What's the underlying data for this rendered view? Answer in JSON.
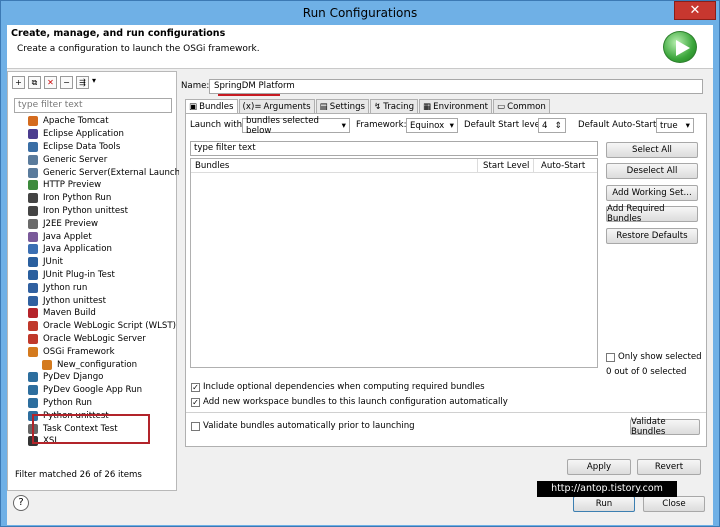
{
  "window": {
    "title": "Run Configurations",
    "close_glyph": "✕"
  },
  "header": {
    "title": "Create, manage, and run configurations",
    "subtitle": "Create a configuration to launch the OSGi framework."
  },
  "left": {
    "filter_placeholder": "type filter text",
    "items": [
      {
        "label": "Apache Tomcat",
        "icon": "tomcat-icon"
      },
      {
        "label": "Eclipse Application",
        "icon": "eclipse-icon"
      },
      {
        "label": "Eclipse Data Tools",
        "icon": "data-tools-icon"
      },
      {
        "label": "Generic Server",
        "icon": "server-icon"
      },
      {
        "label": "Generic Server(External Launch)",
        "icon": "server-icon"
      },
      {
        "label": "HTTP Preview",
        "icon": "http-icon"
      },
      {
        "label": "Iron Python Run",
        "icon": "ironpython-icon"
      },
      {
        "label": "Iron Python unittest",
        "icon": "ironpython-icon"
      },
      {
        "label": "J2EE Preview",
        "icon": "j2ee-icon"
      },
      {
        "label": "Java Applet",
        "icon": "applet-icon"
      },
      {
        "label": "Java Application",
        "icon": "java-app-icon"
      },
      {
        "label": "JUnit",
        "icon": "junit-icon"
      },
      {
        "label": "JUnit Plug-in Test",
        "icon": "junit-plugin-icon"
      },
      {
        "label": "Jython run",
        "icon": "jython-icon"
      },
      {
        "label": "Jython unittest",
        "icon": "jython-icon"
      },
      {
        "label": "Maven Build",
        "icon": "maven-icon"
      },
      {
        "label": "Oracle WebLogic Script (WLST)",
        "icon": "weblogic-icon"
      },
      {
        "label": "Oracle WebLogic Server",
        "icon": "weblogic-icon"
      },
      {
        "label": "OSGi Framework",
        "icon": "osgi-icon"
      },
      {
        "label": "New_configuration",
        "icon": "osgi-icon",
        "child": true
      },
      {
        "label": "PyDev Django",
        "icon": "pydev-icon"
      },
      {
        "label": "PyDev Google App Run",
        "icon": "pydev-icon"
      },
      {
        "label": "Python Run",
        "icon": "python-icon"
      },
      {
        "label": "Python unittest",
        "icon": "python-icon"
      },
      {
        "label": "Task Context Test",
        "icon": "task-icon"
      },
      {
        "label": "XSL",
        "icon": "xsl-icon"
      }
    ],
    "matched": "Filter matched 26 of 26 items"
  },
  "right": {
    "name_label": "Name:",
    "name_value": "SpringDM Platform",
    "tabs": [
      "Bundles",
      "Arguments",
      "Settings",
      "Tracing",
      "Environment",
      "Common"
    ],
    "launch_with_label": "Launch with:",
    "launch_with_value": "bundles selected below",
    "framework_label": "Framework:",
    "framework_value": "Equinox",
    "start_level_label": "Default Start level:",
    "start_level_value": "4",
    "auto_start_label": "Default Auto-Start:",
    "auto_start_value": "true",
    "bundle_filter": "type filter text",
    "col_bundles": "Bundles",
    "col_start": "Start Level",
    "col_auto": "Auto-Start",
    "buttons": [
      "Select All",
      "Deselect All",
      "Add Working Set...",
      "Add Required Bundles",
      "Restore Defaults"
    ],
    "only_show": "Only show selected",
    "selected_count": "0 out of 0 selected",
    "opt_include": "Include optional dependencies when computing required bundles",
    "opt_add": "Add new workspace bundles to this launch configuration automatically",
    "opt_validate": "Validate bundles automatically prior to launching",
    "validate_btn": "Validate Bundles",
    "apply": "Apply",
    "revert": "Revert"
  },
  "footer": {
    "run": "Run",
    "close": "Close",
    "help": "?"
  },
  "watermark": "http://antop.tistory.com"
}
